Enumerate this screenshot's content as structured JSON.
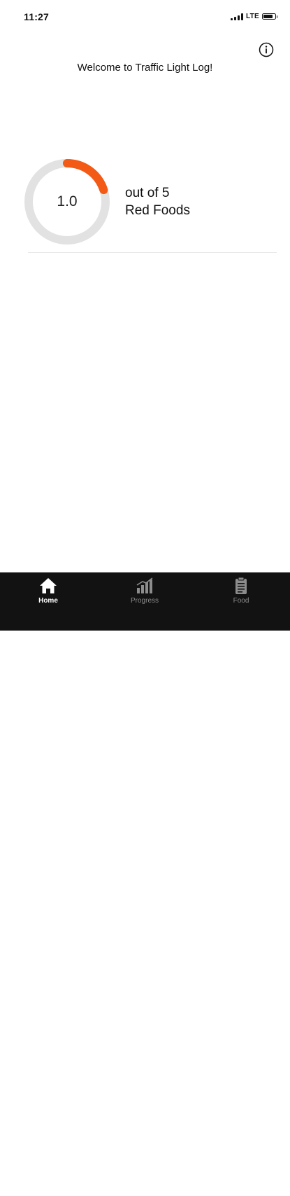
{
  "status_bar": {
    "time": "11:27",
    "network": "LTE"
  },
  "header": {
    "welcome_text": "Welcome to Traffic Light Log!",
    "info_icon": "info-circle-icon"
  },
  "summary": {
    "value_text": "1.0",
    "progress_fraction": 0.2,
    "caption_line1": "out of 5",
    "caption_line2": "Red Foods",
    "progress_color": "#f25a16",
    "track_color": "#e2e2e2"
  },
  "tab_bar": {
    "tabs": [
      {
        "label": "Home",
        "icon": "home-icon",
        "active": true
      },
      {
        "label": "Progress",
        "icon": "bar-chart-icon",
        "active": false
      },
      {
        "label": "Food",
        "icon": "clipboard-icon",
        "active": false
      }
    ]
  }
}
